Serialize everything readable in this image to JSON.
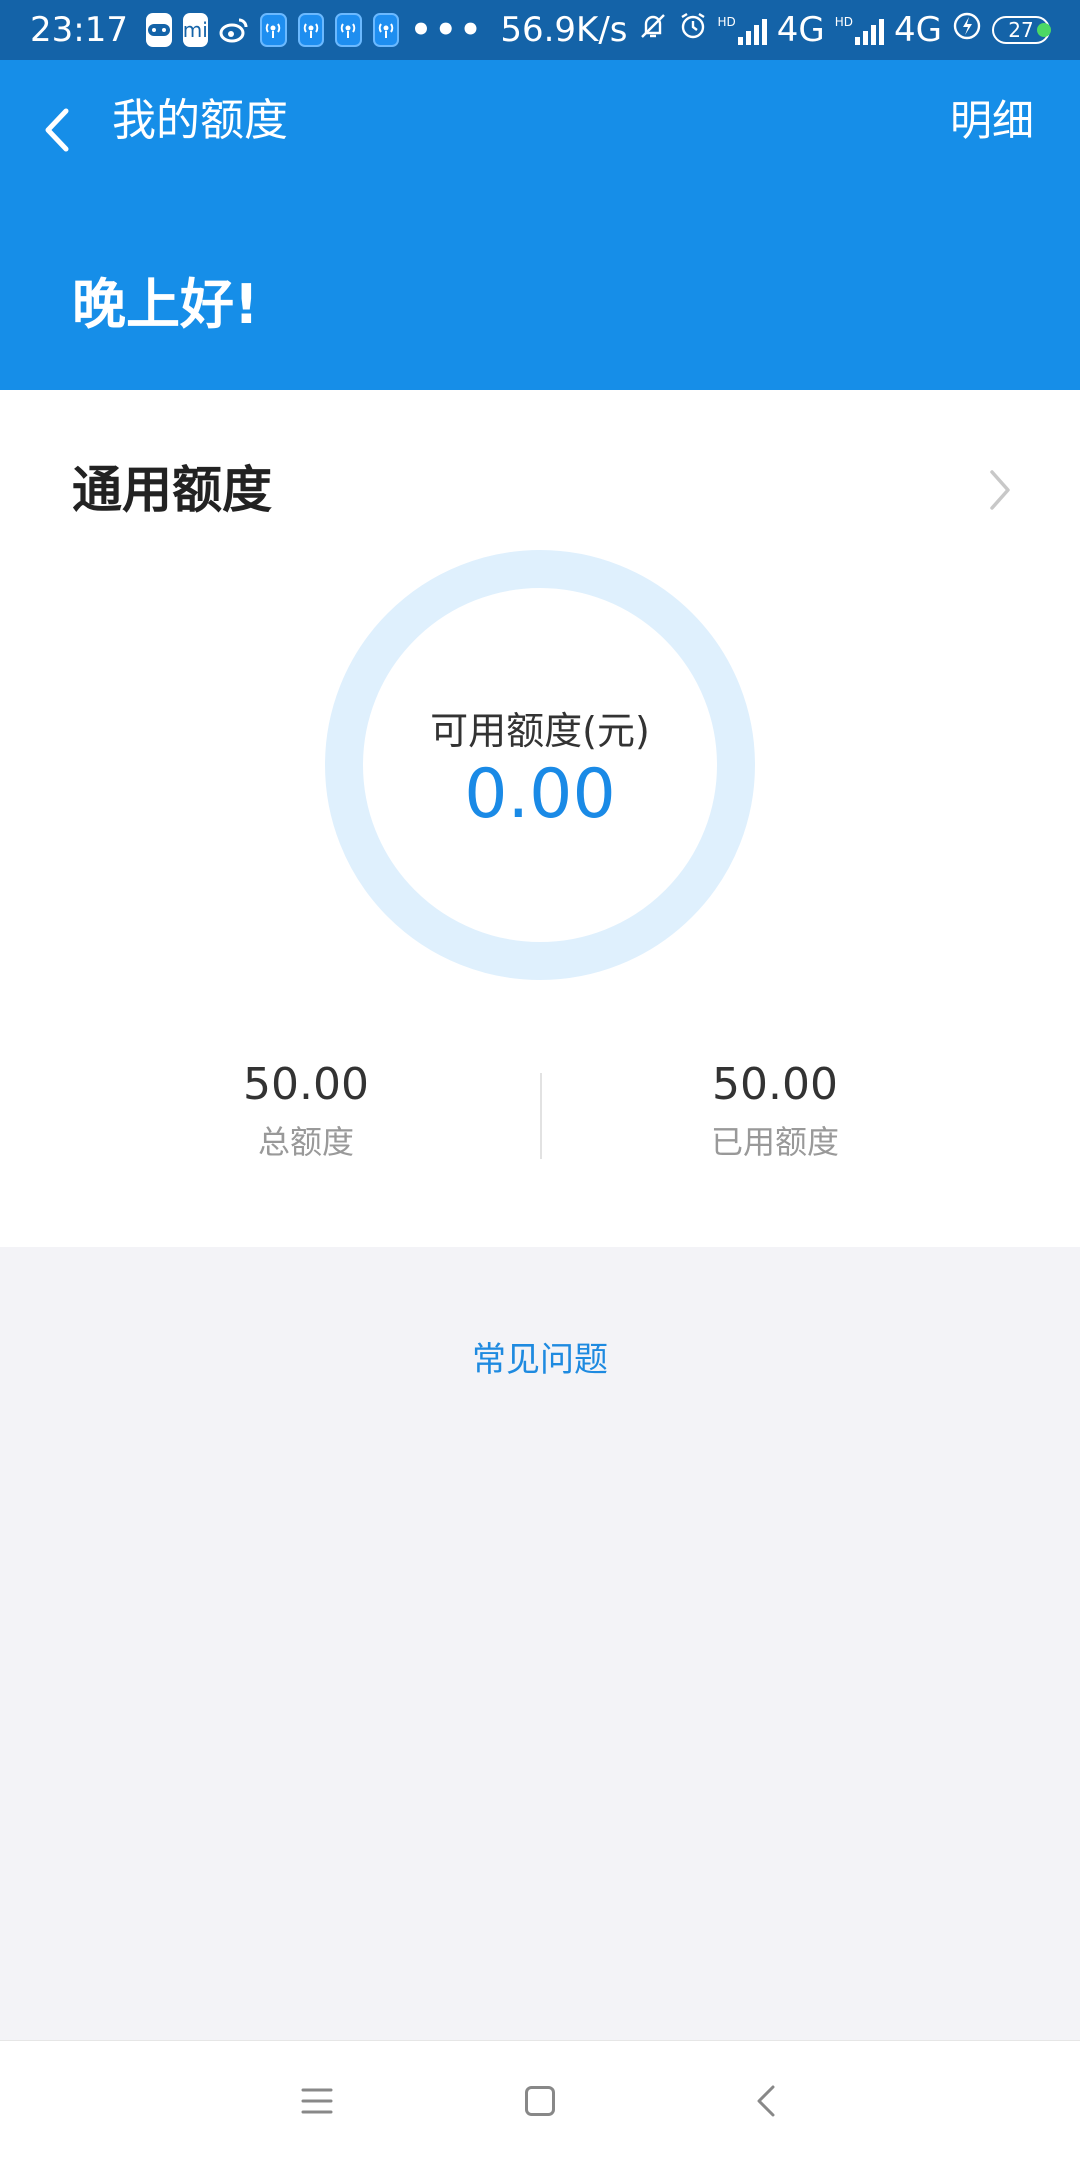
{
  "status_bar": {
    "time": "23:17",
    "app_icons": [
      "game-controller-icon",
      "mi-store-icon",
      "weibo-icon",
      "hotspot-icon",
      "hotspot-icon",
      "hotspot-icon",
      "hotspot-icon"
    ],
    "mi_label": "mi",
    "more_dots": "•••",
    "net_speed": "56.9K/s",
    "hd_label": "HD",
    "network_1": "4G",
    "network_2": "4G",
    "battery": "27"
  },
  "header": {
    "title": "我的额度",
    "detail_label": "明细",
    "greeting": "晚上好!"
  },
  "credit": {
    "section_title": "通用额度",
    "available_label": "可用额度(元)",
    "available_value": "0.00",
    "total_value": "50.00",
    "total_label": "总额度",
    "used_value": "50.00",
    "used_label": "已用额度"
  },
  "faq_label": "常见问题",
  "colors": {
    "status_bar": "#1463a8",
    "header": "#168ee8",
    "accent": "#1a8ae6",
    "ring": "#dff0fd",
    "background": "#f3f3f7"
  }
}
